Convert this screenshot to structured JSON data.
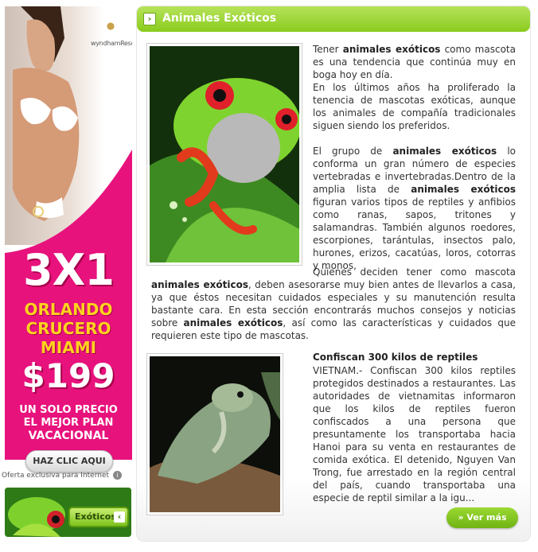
{
  "ad": {
    "brand": "wyndhamResorts",
    "headline": "3X1",
    "line1": "ORLANDO",
    "line2": "CRUCERO",
    "line3": "MIAMI",
    "price": "$199",
    "sub1": "UN SOLO PRECIO",
    "sub2": "EL MEJOR PLAN",
    "sub3": "VACACIONAL",
    "cta": "HAZ CLIC AQUI",
    "offer": "Oferta exclusiva para Internet",
    "info_icon": "i",
    "pink": "#e8127d"
  },
  "exoticos_link": {
    "label": "Exóticos",
    "arrow": "‹"
  },
  "panel": {
    "title": "Animales Exóticos",
    "title_arrow": "›",
    "accent": "#8acb1e",
    "intro": {
      "p1_pre": "Tener ",
      "p1_bold": "animales exóticos",
      "p1_post": " como mascota es una tendencia que continúa muy en boga hoy en día.",
      "p2": "En los últimos años ha proliferado la tenencia de mascotas exóticas, aunque los animales de compañía tradicionales siguen siendo los preferidos.",
      "p3_pre": "El grupo de ",
      "p3_bold": "animales exóticos",
      "p3_mid": " lo conforma un gran número de especies vertebradas e invertebradas.Dentro de la amplia lista de ",
      "p3_bold2": "animales exóticos",
      "p3_post": " figuran varios tipos de reptiles y anfibios como ranas, sapos, tritones y salamandras. También algunos roedores, escorpiones, tarántulas, insectos palo, hurones, erizos, cacatúas, loros, cotorras y monos,",
      "p4_pre": "Quienes deciden tener como mascota ",
      "p4_bold": "animales exóticos",
      "p4_mid": ", deben asesorarse muy bien antes de llevarlos a casa, ya que éstos necesitan cuidados especiales y su manutención resulta bastante cara. En esta sección encontrarás muchos consejos y noticias sobre ",
      "p4_bold2": "animales exóticos",
      "p4_post": ", así como las características y cuidados que requieren este tipo de mascotas."
    },
    "article": {
      "title": "Confiscan 300 kilos de reptiles",
      "body": "VIETNAM.- Confiscan 300 kilos reptiles protegidos destinados a restaurantes. Las autoridades de vietnamitas informaron que los kilos de reptiles fueron confiscados a una persona que presuntamente los transportaba hacia Hanoi para su venta en restaurantes de comida exótica. El detenido, Nguyen Van Trong, fue arrestado en la región central del país, cuando transportaba una especie de reptil similar a la igu..."
    },
    "more_button": "» Ver más"
  }
}
